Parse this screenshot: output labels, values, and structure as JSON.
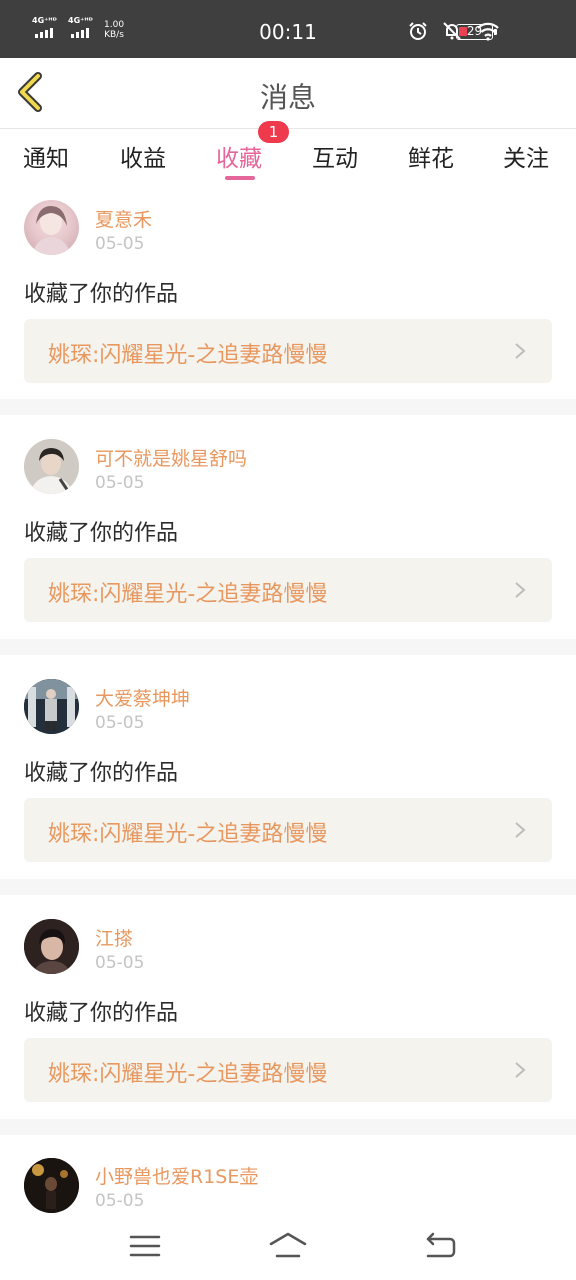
{
  "status_bar": {
    "sim1_label": "4G⁺ᴴᴰ",
    "sim2_label": "4G⁺ᴴᴰ",
    "net_speed_value": "1.00",
    "net_speed_unit": "KB/s",
    "time": "00:11",
    "battery_level": "29"
  },
  "header": {
    "title": "消息"
  },
  "tabs": [
    {
      "label": "通知"
    },
    {
      "label": "收益"
    },
    {
      "label": "收藏",
      "badge": "1",
      "active": true
    },
    {
      "label": "互动"
    },
    {
      "label": "鲜花"
    },
    {
      "label": "关注"
    }
  ],
  "messages": [
    {
      "username": "夏意禾",
      "date": "05-05",
      "action": "收藏了你的作品",
      "work_title": "姚琛:闪耀星光-之追妻路慢慢"
    },
    {
      "username": "可不就是姚星舒吗",
      "date": "05-05",
      "action": "收藏了你的作品",
      "work_title": "姚琛:闪耀星光-之追妻路慢慢"
    },
    {
      "username": "大爱蔡坤坤",
      "date": "05-05",
      "action": "收藏了你的作品",
      "work_title": "姚琛:闪耀星光-之追妻路慢慢"
    },
    {
      "username": "江搽",
      "date": "05-05",
      "action": "收藏了你的作品",
      "work_title": "姚琛:闪耀星光-之追妻路慢慢"
    },
    {
      "username": "小野兽也爱R1SE壶",
      "date": "05-05"
    }
  ],
  "colors": {
    "accent_pink": "#e5669b",
    "username_orange": "#e8985f",
    "badge_red": "#ee3a4c",
    "card_bg": "#f5f3ee"
  },
  "icons": {
    "back": "back-chevron-icon",
    "work_arrow": "chevron-right-icon",
    "nav_menu": "menu-icon",
    "nav_home": "home-icon",
    "nav_back": "return-icon"
  }
}
